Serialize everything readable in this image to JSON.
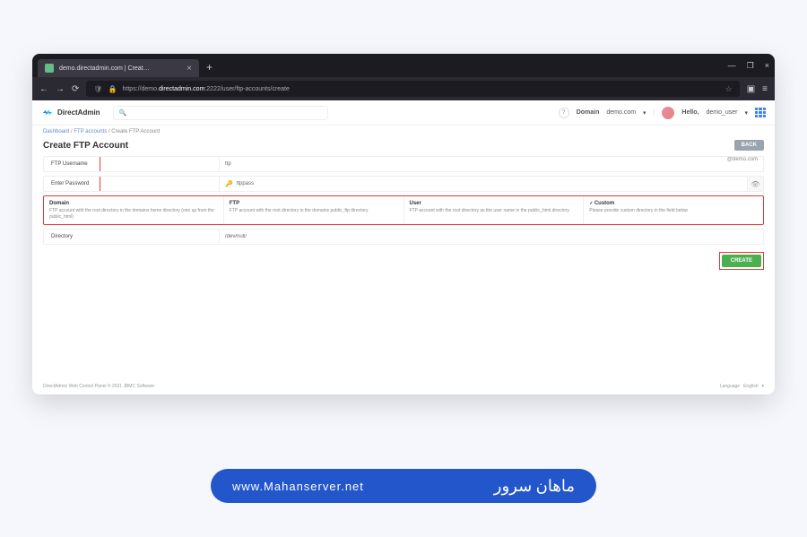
{
  "browser": {
    "tab_title": "demo.directadmin.com | Creat…",
    "url_prefix": "https://demo.",
    "url_domain": "directadmin.com",
    "url_suffix": ":2222/user/ftp-accounts/create"
  },
  "header": {
    "brand": "DirectAdmin",
    "domain_label": "Domain",
    "domain_value": "demo.com",
    "hello": "Hello,",
    "user": "demo_user"
  },
  "breadcrumb": {
    "dashboard": "Dashboard",
    "ftp": "FTP accounts",
    "current": "Create FTP Account"
  },
  "page": {
    "title": "Create FTP Account",
    "back": "BACK"
  },
  "form": {
    "username_label": "FTP Username",
    "username_value": "ftp",
    "username_suffix": "@demo.com",
    "password_label": "Enter Password",
    "password_value": "ftppass",
    "directory_label": "Directory",
    "directory_value": "/dev/null/"
  },
  "cards": [
    {
      "title": "Domain",
      "desc": "FTP account with the root directory in the domains home directory (one up from the public_html)"
    },
    {
      "title": "FTP",
      "desc": "FTP account with the root directory in the domains public_ftp directory"
    },
    {
      "title": "User",
      "desc": "FTP account with the root directory as the user name in the public_html directory"
    },
    {
      "title": "Custom",
      "desc": "Please provide custom directory in the field below"
    }
  ],
  "actions": {
    "create": "CREATE"
  },
  "footer": {
    "copyright": "DirectAdmin Web Control Panel © 2021 JBMC Software",
    "language_label": "Language",
    "language_value": "English"
  },
  "watermark": {
    "url": "www.Mahanserver.net",
    "brand": "ماهان سرور"
  }
}
